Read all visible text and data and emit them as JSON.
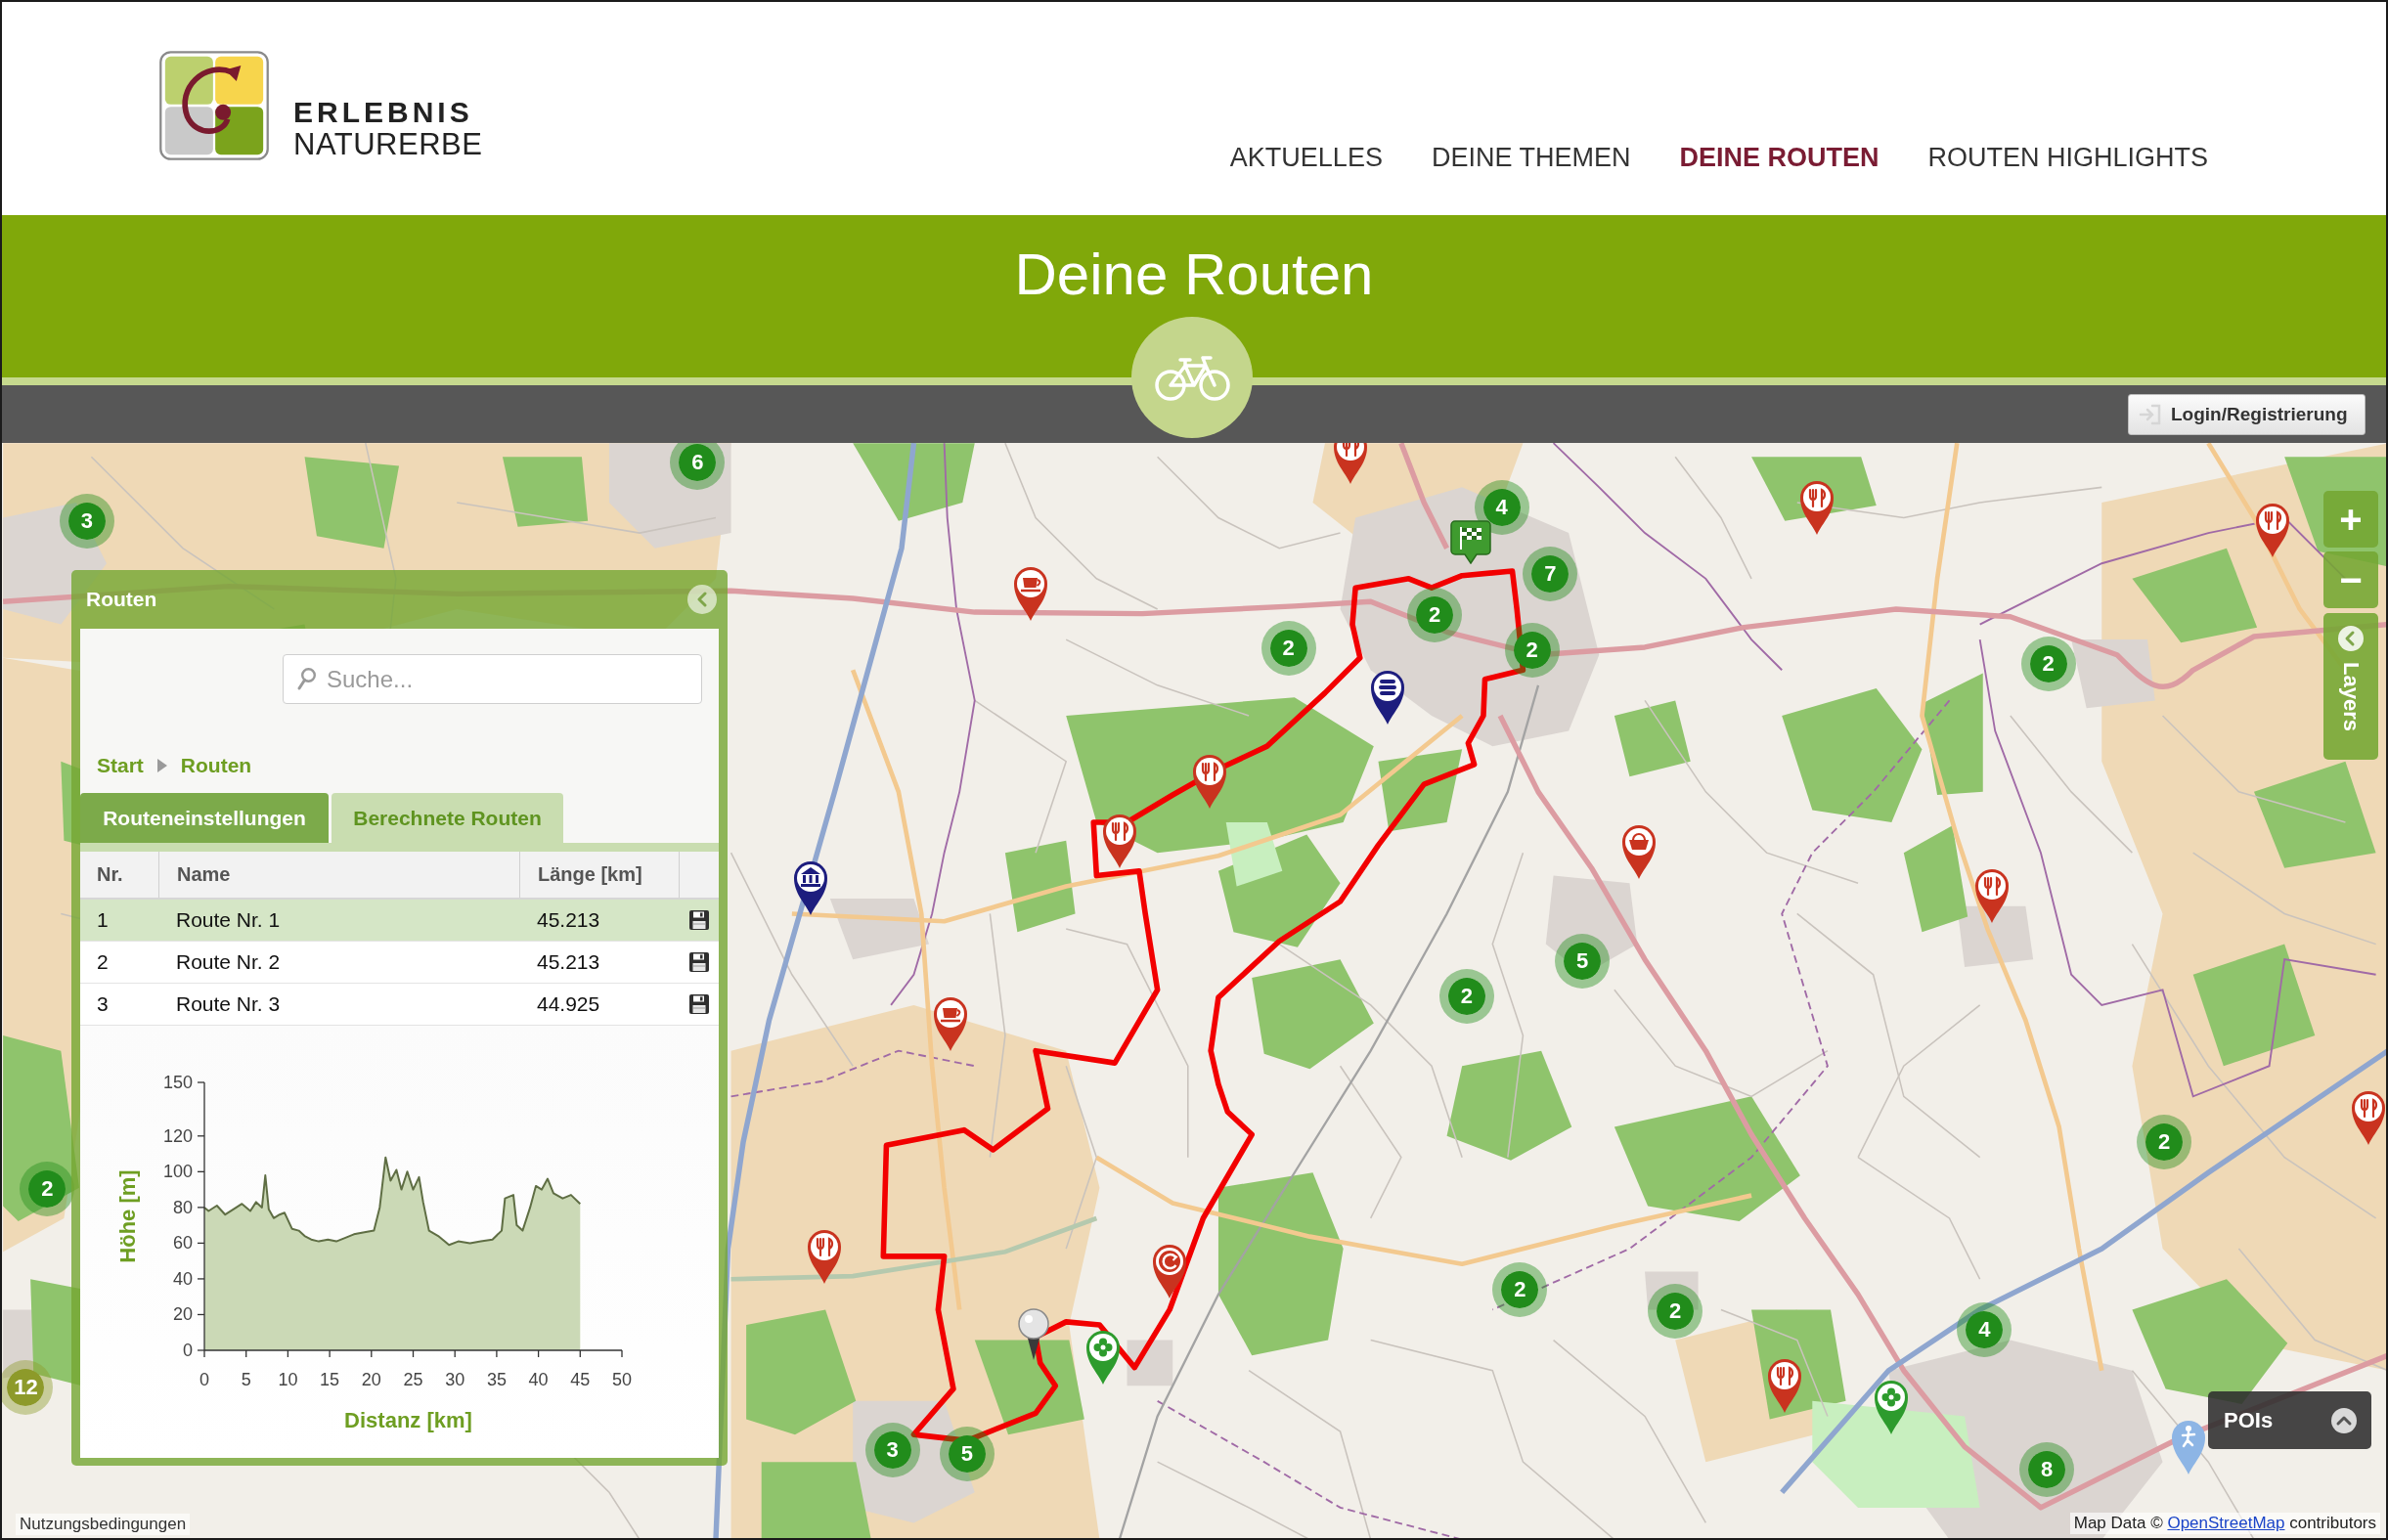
{
  "header": {
    "logo": {
      "line_1": "ERLEBNIS",
      "line_2": "NATURERBE"
    },
    "nav": [
      {
        "label": "AKTUELLES",
        "selected": false
      },
      {
        "label": "DEINE THEMEN",
        "selected": false
      },
      {
        "label": "DEINE ROUTEN",
        "selected": true
      },
      {
        "label": "ROUTEN HIGHLIGHTS",
        "selected": false
      }
    ]
  },
  "banner": {
    "title": "Deine Routen"
  },
  "toolbar": {
    "login_button": "Login/Registrierung"
  },
  "route_panel": {
    "title": "Routen",
    "search": {
      "placeholder": "Suche..."
    },
    "breadcrumb": [
      {
        "label": "Start"
      },
      {
        "label": "Routen"
      }
    ],
    "tabs": [
      {
        "label": "Routeneinstellungen",
        "selected": false
      },
      {
        "label": "Berechnete Routen",
        "selected": true
      }
    ],
    "table": {
      "columns": [
        "Nr.",
        "Name",
        "Länge [km]"
      ],
      "rows": [
        {
          "nr": "1",
          "name": "Route Nr. 1",
          "length": "45.213",
          "selected": true
        },
        {
          "nr": "2",
          "name": "Route Nr. 2",
          "length": "45.213",
          "selected": false
        },
        {
          "nr": "3",
          "name": "Route Nr. 3",
          "length": "44.925",
          "selected": false
        }
      ]
    },
    "chart_data": {
      "type": "area",
      "xlabel": "Distanz [km]",
      "ylabel": "Höhe [m]",
      "x": [
        0,
        0.5,
        1.5,
        2.5,
        3.5,
        4.5,
        5.5,
        6.2,
        6.9,
        7.3,
        7.7,
        8.3,
        9,
        9.6,
        10.5,
        11.3,
        12,
        12.8,
        13.7,
        14.8,
        15.8,
        16.9,
        17.9,
        19,
        20.3,
        21,
        21.7,
        22.3,
        23,
        23.6,
        24.3,
        25,
        25.7,
        26.2,
        26.9,
        28,
        29.3,
        30.4,
        31.8,
        33.1,
        34.5,
        35.6,
        36,
        37,
        37.4,
        38.1,
        39,
        39.7,
        40.4,
        41.1,
        41.8,
        42.9,
        43.9,
        45
      ],
      "values": [
        80,
        78,
        81,
        76,
        79,
        82,
        78,
        83,
        80,
        98,
        79,
        74,
        76,
        77,
        68,
        67,
        64,
        62,
        61,
        62,
        61,
        63,
        65,
        66,
        67,
        80,
        108,
        95,
        101,
        90,
        100,
        90,
        97,
        83,
        67,
        64,
        59,
        61,
        60,
        61,
        62,
        67,
        85,
        87,
        70,
        67,
        80,
        92,
        90,
        96,
        88,
        85,
        87,
        82
      ],
      "xlim": [
        0,
        50
      ],
      "ylim": [
        0,
        150
      ],
      "xticks": [
        0,
        5,
        10,
        15,
        20,
        25,
        30,
        35,
        40,
        45,
        50
      ],
      "yticks": [
        0,
        20,
        40,
        60,
        80,
        100,
        120,
        150
      ]
    }
  },
  "map": {
    "clusters": [
      {
        "count": "6",
        "color": "#218c1b"
      },
      {
        "count": "4",
        "color": "#218c1b"
      },
      {
        "count": "3",
        "color": "#218c1b"
      },
      {
        "count": "7",
        "color": "#218c1b"
      },
      {
        "count": "2",
        "color": "#218c1b"
      },
      {
        "count": "2",
        "color": "#218c1b"
      },
      {
        "count": "2",
        "color": "#218c1b"
      },
      {
        "count": "2",
        "color": "#218c1b"
      },
      {
        "count": "5",
        "color": "#218c1b"
      },
      {
        "count": "2",
        "color": "#218c1b"
      },
      {
        "count": "2",
        "color": "#218c1b"
      },
      {
        "count": "2",
        "color": "#218c1b"
      },
      {
        "count": "2",
        "color": "#218c1b"
      },
      {
        "count": "2",
        "color": "#218c1b"
      },
      {
        "count": "4",
        "color": "#218c1b"
      },
      {
        "count": "12",
        "color": "#8d9a2a"
      },
      {
        "count": "3",
        "color": "#218c1b"
      },
      {
        "count": "5",
        "color": "#218c1b"
      },
      {
        "count": "8",
        "color": "#218c1b"
      }
    ],
    "controls": {
      "zoom_in": "+",
      "zoom_out": "−",
      "layers": "Layers"
    },
    "pois_control": {
      "label": "POIs"
    },
    "attribution": {
      "prefix": "Map Data © ",
      "link": "OpenStreetMap",
      "suffix": " contributors"
    },
    "terms_link": "Nutzungsbedingungen"
  }
}
